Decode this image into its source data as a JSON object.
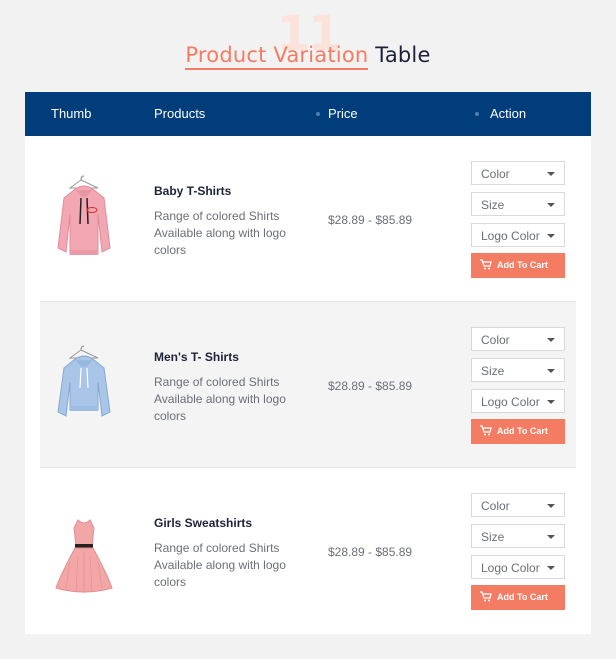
{
  "header": {
    "number": "11",
    "title_accent": "Product Variation",
    "title_rest": "Table"
  },
  "table": {
    "columns": [
      "Thumb",
      "Products",
      "Price",
      "Action"
    ],
    "rows": [
      {
        "name": "Baby T-Shirts",
        "description": "Range of colored Shirts Available along with logo colors",
        "price": "$28.89 - $85.89",
        "selects": [
          "Color",
          "Size",
          "Logo Color"
        ],
        "button": "Add To Cart",
        "thumb_icon": "pink-hoodie-image"
      },
      {
        "name": "Men's T- Shirts",
        "description": "Range of colored Shirts Available along with logo colors",
        "price": "$28.89 - $85.89",
        "selects": [
          "Color",
          "Size",
          "Logo Color"
        ],
        "button": "Add To Cart",
        "thumb_icon": "blue-hoodie-image"
      },
      {
        "name": "Girls Sweatshirts",
        "description": "Range of colored Shirts Available along with logo colors",
        "price": "$28.89 - $85.89",
        "selects": [
          "Color",
          "Size",
          "Logo Color"
        ],
        "button": "Add To Cart",
        "thumb_icon": "pink-dress-image"
      }
    ]
  },
  "colors": {
    "accent": "#f47c63",
    "header_bg": "#003d7a",
    "title_dark": "#1d2238"
  }
}
